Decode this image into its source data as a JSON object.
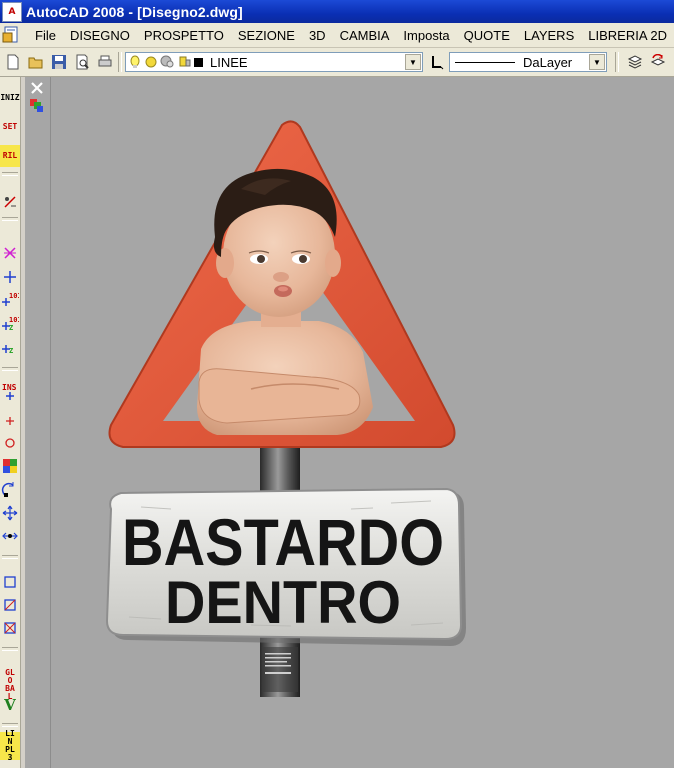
{
  "window": {
    "title": "AutoCAD 2008 - [Disegno2.dwg]"
  },
  "menu": {
    "items": [
      "File",
      "DISEGNO",
      "PROSPETTO",
      "SEZIONE",
      "3D",
      "CAMBIA",
      "Imposta",
      "QUOTE",
      "LAYERS",
      "LIBRERIA 2D"
    ]
  },
  "toolbar": {
    "layer_value": "LINEE",
    "linetype_value": "DaLayer",
    "layer_color": "#000000"
  },
  "left_toolbar": {
    "items": [
      "INIZ",
      "SET",
      "RIL",
      "GLO BAL",
      "V",
      "LIN PL3"
    ]
  },
  "canvas": {
    "sign_line1": "BASTARDO",
    "sign_line2": "DENTRO",
    "triangle_color": "#e0583b",
    "background_color": "#a6a6a6"
  }
}
